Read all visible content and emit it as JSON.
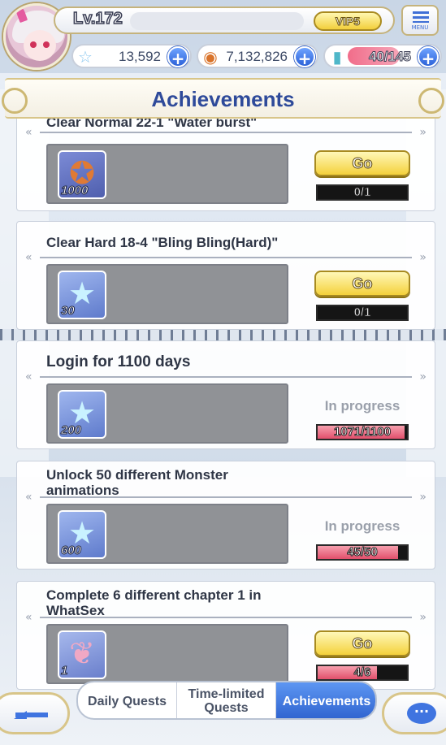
{
  "header": {
    "level": "Lv.172",
    "vip": "VIP5",
    "menu_label": "MENU",
    "resources": [
      {
        "icon": "star-crystal-icon",
        "value": "13,592"
      },
      {
        "icon": "coin-icon",
        "value": "7,132,826"
      },
      {
        "icon": "stamina-bottle-icon",
        "value": "40/145"
      }
    ]
  },
  "page_title": "Achievements",
  "quests": [
    {
      "title": "Clear Normal 22-1 \"Water burst\"",
      "reward_icon": "coin-icon",
      "reward_qty": "1000",
      "action": "Go",
      "progress": "0/1",
      "progress_frac": 0.0
    },
    {
      "title": "Clear Hard 18-4 \"Bling Bling(Hard)\"",
      "reward_icon": "star-crystal-icon",
      "reward_qty": "30",
      "action": "Go",
      "progress": "0/1",
      "progress_frac": 0.0
    },
    {
      "title": "Login for 1100 days",
      "reward_icon": "star-crystal-icon",
      "reward_qty": "200",
      "status": "In progress",
      "progress": "1071/1100",
      "progress_frac": 0.974
    },
    {
      "title": "Unlock 50 different Monster animations",
      "reward_icon": "star-crystal-icon",
      "reward_qty": "600",
      "status": "In progress",
      "progress": "45/50",
      "progress_frac": 0.9
    },
    {
      "title": "Complete 6 different chapter 1 in WhatSex",
      "reward_icon": "feather-icon",
      "reward_qty": "1",
      "action": "Go",
      "progress": "4/6",
      "progress_frac": 0.667
    }
  ],
  "tabs": [
    {
      "label": "Daily Quests",
      "active": false
    },
    {
      "label": "Time-limited Quests",
      "active": false
    },
    {
      "label": "Achievements",
      "active": true
    }
  ],
  "colors": {
    "accent": "#2f63cf",
    "gold": "#f4d13c",
    "progress": "#e2506c"
  }
}
